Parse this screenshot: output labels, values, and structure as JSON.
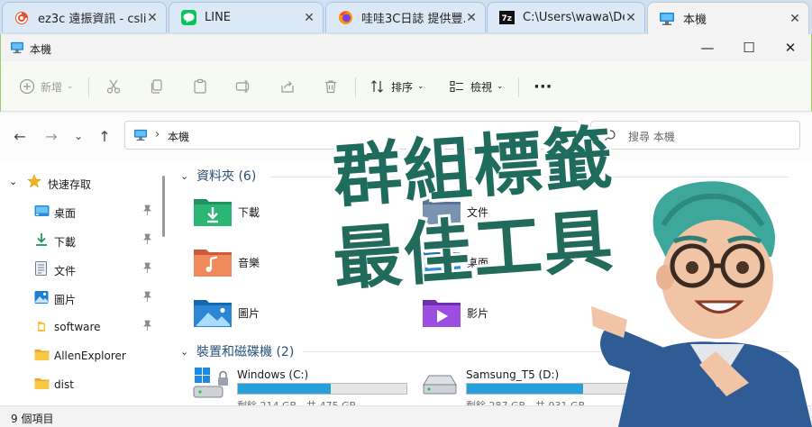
{
  "tabs": [
    {
      "title": "ez3c 遠振資訊 - csli...",
      "icon": "swirl-icon",
      "active": false
    },
    {
      "title": "LINE",
      "icon": "line-app-icon",
      "active": false
    },
    {
      "title": "哇哇3C日誌 提供豐...",
      "icon": "firefox-icon",
      "active": false
    },
    {
      "title": "C:\\Users\\wawa\\Des...",
      "icon": "7zip-icon",
      "active": false
    },
    {
      "title": "本機",
      "icon": "this-pc-icon",
      "active": true
    }
  ],
  "window": {
    "title": "本機",
    "minimize": "—",
    "maximize": "☐",
    "close": "✕"
  },
  "toolbar": {
    "new_label": "新增",
    "sort_label": "排序",
    "view_label": "檢視",
    "more_label": "···"
  },
  "nav": {
    "back": "←",
    "forward": "→",
    "recent": "⌄",
    "up": "↑",
    "path": "本機",
    "path_sep": "›",
    "refresh": "⟳",
    "search_placeholder": "搜尋 本機"
  },
  "sidebar": {
    "quick_access_label": "快速存取",
    "items": [
      {
        "label": "桌面",
        "icon": "desktop-icon",
        "pinned": true
      },
      {
        "label": "下載",
        "icon": "download-icon",
        "pinned": true
      },
      {
        "label": "文件",
        "icon": "document-icon",
        "pinned": true
      },
      {
        "label": "圖片",
        "icon": "pictures-icon",
        "pinned": true
      },
      {
        "label": "software",
        "icon": "folder-icon",
        "pinned": true
      },
      {
        "label": "AllenExplorer",
        "icon": "folder-icon",
        "pinned": false
      },
      {
        "label": "dist",
        "icon": "folder-icon",
        "pinned": false
      }
    ],
    "pin_glyph": "📌"
  },
  "main": {
    "folders_group": "資料夾 (6)",
    "folders": [
      {
        "label": "下載",
        "icon": "downloads-folder-icon"
      },
      {
        "label": "文件",
        "icon": "documents-folder-icon"
      },
      {
        "label": "音樂",
        "icon": "music-folder-icon"
      },
      {
        "label": "桌面",
        "icon": "desktop-folder-icon"
      },
      {
        "label": "圖片",
        "icon": "pictures-folder-icon"
      },
      {
        "label": "影片",
        "icon": "videos-folder-icon"
      }
    ],
    "drives_group": "裝置和磁碟機 (2)",
    "drives": [
      {
        "label": "Windows (C:)",
        "icon": "windows-drive-icon",
        "free": "剩餘 214 GB，共 475 GB",
        "used_fraction": 0.55
      },
      {
        "label": "Samsung_T5 (D:)",
        "icon": "external-drive-icon",
        "free": "剩餘 287 GB，共 931 GB",
        "used_fraction": 0.69
      }
    ]
  },
  "status": {
    "item_count": "9 個項目"
  },
  "overlay": {
    "line1": "群組標籤",
    "line2": "最佳工具"
  },
  "colors": {
    "accent": "#26a0da",
    "headline": "#1f6b5e",
    "title_border": "#9ccb6b"
  }
}
